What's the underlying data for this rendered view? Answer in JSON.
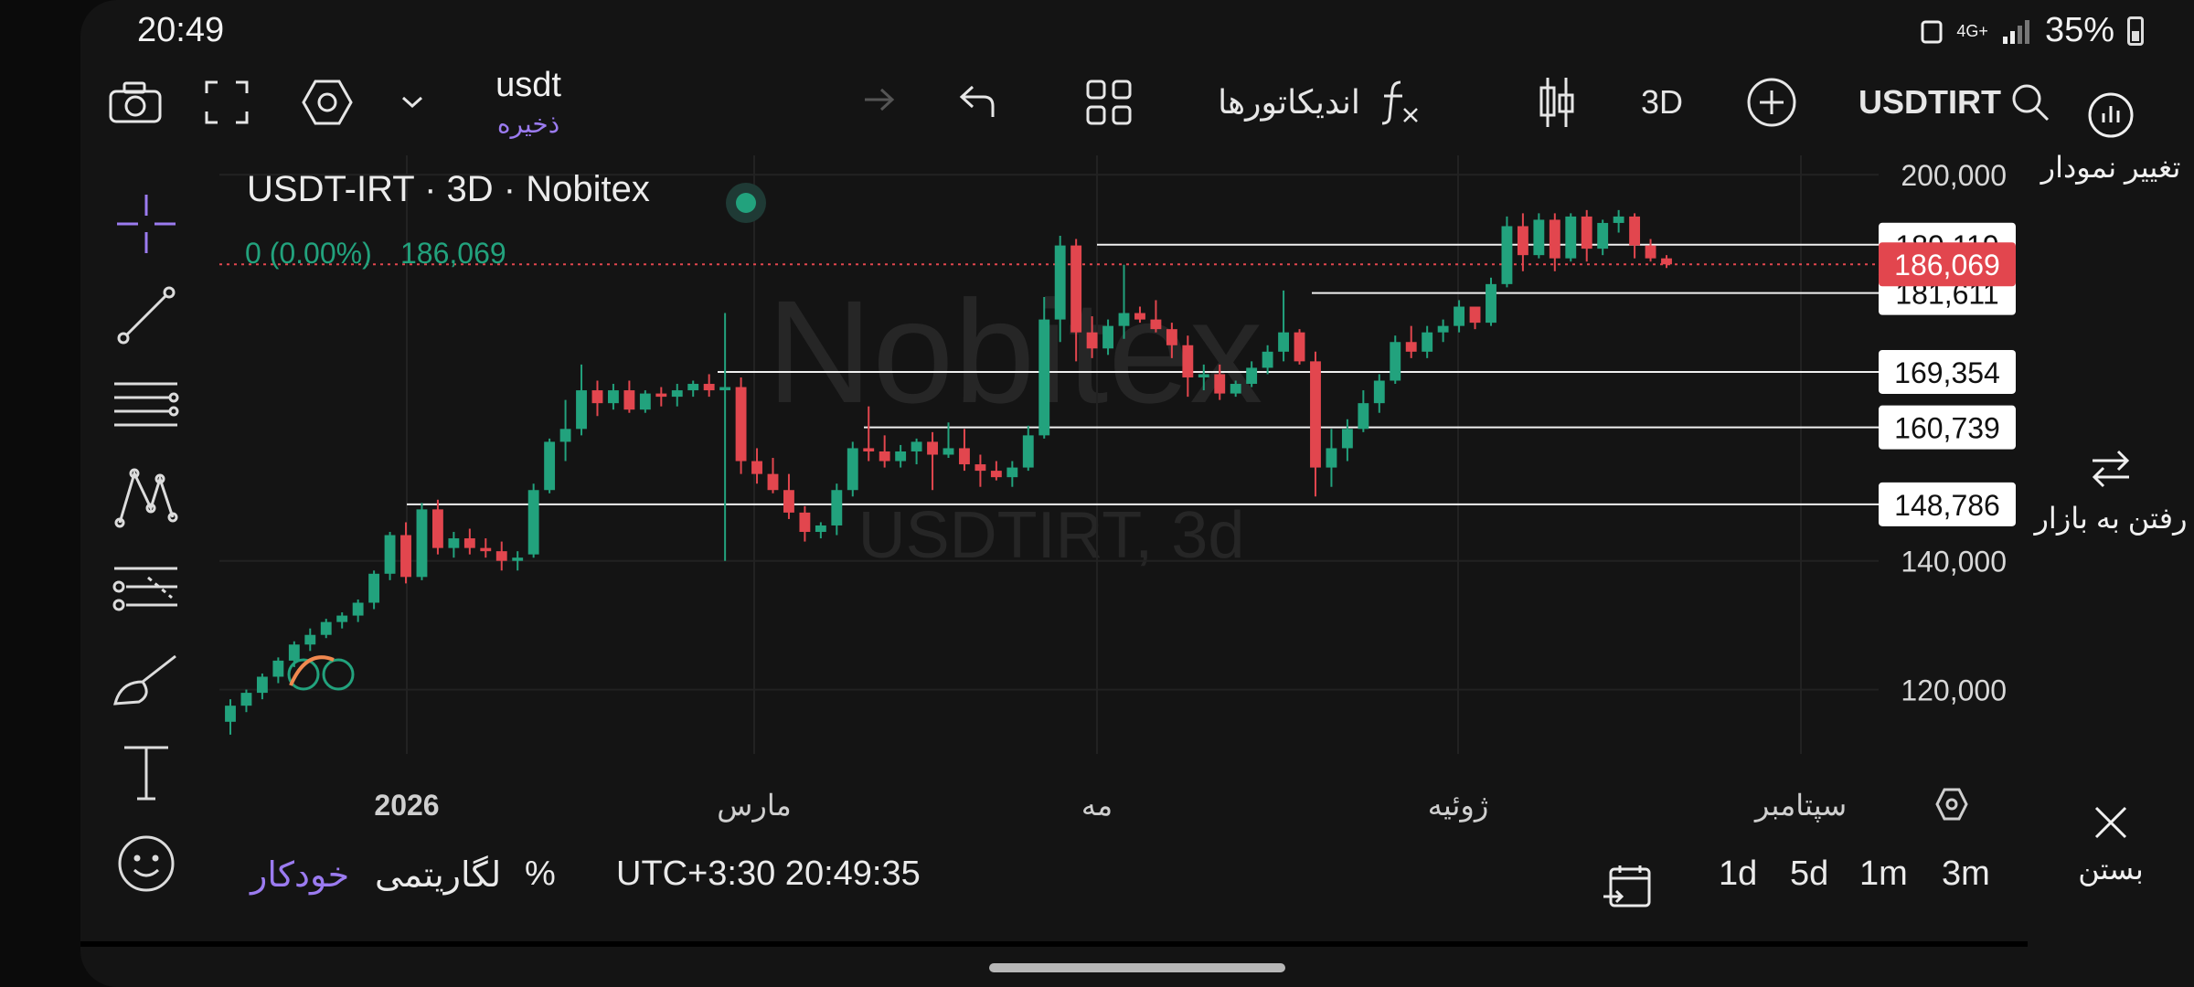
{
  "status_bar": {
    "time": "20:49",
    "network": "4G+",
    "battery": "35%"
  },
  "toolbar": {
    "symbol_name": "usdt",
    "save_label": "ذخیره",
    "indicators_label": "اندیکاتورها",
    "interval_label": "3D",
    "ticker": "USDTIRT"
  },
  "right_sidebar": {
    "change_chart_label": "تغییر نمودار",
    "go_market_label": "رفتن به بازار",
    "close_label": "بستن"
  },
  "chart_header": {
    "title": "USDT-IRT · 3D · Nobitex",
    "change_text": "0 (0.00%)",
    "last_price_text": "186,069"
  },
  "watermark": {
    "line1": "Nobitex",
    "line2": "USDTIRT, 3d"
  },
  "bottom_bar": {
    "auto_label": "خودکار",
    "log_label": "لگاریتمی",
    "percent_label": "%",
    "timezone_clock": "UTC+3:30 20:49:35",
    "ranges": [
      "1d",
      "5d",
      "1m",
      "3m"
    ]
  },
  "colors": {
    "up": "#22a27d",
    "down": "#e2464e",
    "accent": "#9b7bf0",
    "last_price_bg": "#e2464e",
    "background": "#141414"
  },
  "chart_data": {
    "type": "candlestick",
    "title": "USDT-IRT · 3D · Nobitex",
    "x_ticks": [
      "2026",
      "مارس",
      "مه",
      "ژوئیه",
      "سپتامبر"
    ],
    "y_ticks": [
      "200,000",
      "140,000",
      "120,000"
    ],
    "y_tick_values": [
      200000,
      140000,
      120000
    ],
    "ylim": [
      110000,
      203000
    ],
    "last_price": 186069,
    "last_price_label": "186,069",
    "horizontal_levels": [
      {
        "value": 189119,
        "label": "189,119"
      },
      {
        "value": 181611,
        "label": "181,611"
      },
      {
        "value": 169354,
        "label": "169,354"
      },
      {
        "value": 160739,
        "label": "160,739"
      },
      {
        "value": 148786,
        "label": "148,786"
      }
    ],
    "ohlc": [
      [
        115000,
        118500,
        113000,
        117500
      ],
      [
        117500,
        120000,
        116500,
        119500
      ],
      [
        119500,
        122500,
        118500,
        122000
      ],
      [
        122000,
        125000,
        121000,
        124500
      ],
      [
        124500,
        127500,
        123500,
        127000
      ],
      [
        127000,
        129500,
        126000,
        128500
      ],
      [
        128500,
        131000,
        128000,
        130500
      ],
      [
        130500,
        132000,
        129500,
        131500
      ],
      [
        131500,
        134000,
        130500,
        133500
      ],
      [
        133500,
        138500,
        132500,
        138000
      ],
      [
        138000,
        144500,
        137000,
        144000
      ],
      [
        144000,
        146000,
        136500,
        137500
      ],
      [
        137500,
        149000,
        137000,
        148000
      ],
      [
        148000,
        149500,
        141000,
        142000
      ],
      [
        142000,
        144500,
        140500,
        143500
      ],
      [
        143500,
        145000,
        141000,
        142000
      ],
      [
        142000,
        143500,
        140500,
        141500
      ],
      [
        141500,
        143000,
        138500,
        140000
      ],
      [
        140000,
        141500,
        138500,
        140500
      ],
      [
        141000,
        152000,
        140500,
        151000
      ],
      [
        151000,
        159000,
        150500,
        158500
      ],
      [
        158500,
        165000,
        155500,
        160500
      ],
      [
        160500,
        170500,
        159500,
        166500
      ],
      [
        166500,
        168000,
        162500,
        164500
      ],
      [
        164500,
        167500,
        163500,
        166500
      ],
      [
        166500,
        168000,
        163000,
        163500
      ],
      [
        163500,
        166500,
        163000,
        166000
      ],
      [
        166000,
        167000,
        164000,
        165500
      ],
      [
        165500,
        167500,
        164000,
        166500
      ],
      [
        166500,
        168000,
        165500,
        167500
      ],
      [
        167500,
        169000,
        165500,
        166500
      ],
      [
        166500,
        178500,
        140000,
        167000
      ],
      [
        167000,
        168500,
        153500,
        155500
      ],
      [
        155500,
        157500,
        152000,
        153500
      ],
      [
        153500,
        156000,
        150500,
        151000
      ],
      [
        151000,
        153500,
        146500,
        147500
      ],
      [
        147500,
        148500,
        143000,
        144500
      ],
      [
        144500,
        146000,
        143500,
        145500
      ],
      [
        145500,
        152000,
        144000,
        151000
      ],
      [
        151000,
        158500,
        150000,
        157500
      ],
      [
        157500,
        164000,
        155500,
        157000
      ],
      [
        157000,
        159500,
        154500,
        155500
      ],
      [
        155500,
        158000,
        154500,
        157000
      ],
      [
        157000,
        159000,
        155000,
        158500
      ],
      [
        158500,
        160000,
        151000,
        156500
      ],
      [
        156500,
        161500,
        156000,
        157500
      ],
      [
        157500,
        160500,
        154000,
        155000
      ],
      [
        155000,
        156500,
        151500,
        154000
      ],
      [
        154000,
        155500,
        152500,
        153000
      ],
      [
        153000,
        155500,
        151500,
        154500
      ],
      [
        154500,
        161000,
        154000,
        159500
      ],
      [
        159500,
        181000,
        159000,
        177500
      ],
      [
        177500,
        190500,
        174000,
        189000
      ],
      [
        189000,
        190000,
        171000,
        175500
      ],
      [
        175500,
        178000,
        171500,
        173000
      ],
      [
        173000,
        177500,
        172000,
        176500
      ],
      [
        176500,
        186000,
        174500,
        178500
      ],
      [
        178500,
        179500,
        177000,
        177500
      ],
      [
        177500,
        180500,
        175500,
        176000
      ],
      [
        176000,
        177000,
        171500,
        173500
      ],
      [
        173500,
        175000,
        165500,
        168500
      ],
      [
        168500,
        170500,
        166500,
        169000
      ],
      [
        169000,
        170500,
        165000,
        166000
      ],
      [
        166000,
        168000,
        165500,
        167500
      ],
      [
        167500,
        171000,
        167000,
        170000
      ],
      [
        170000,
        173500,
        169000,
        172500
      ],
      [
        172500,
        182000,
        171000,
        175500
      ],
      [
        175500,
        176000,
        170500,
        171000
      ],
      [
        171000,
        172500,
        150000,
        154500
      ],
      [
        154500,
        160500,
        151500,
        157500
      ],
      [
        157500,
        162000,
        155500,
        160500
      ],
      [
        160500,
        166500,
        160000,
        164500
      ],
      [
        164500,
        169000,
        163000,
        168000
      ],
      [
        168000,
        175000,
        167500,
        174000
      ],
      [
        174000,
        176500,
        171500,
        172500
      ],
      [
        172500,
        176500,
        171500,
        175500
      ],
      [
        175500,
        177500,
        174000,
        176500
      ],
      [
        176500,
        180500,
        175500,
        179500
      ],
      [
        179500,
        178500,
        176000,
        177000
      ],
      [
        177000,
        184000,
        176500,
        183000
      ],
      [
        183000,
        193500,
        182500,
        192000
      ],
      [
        192000,
        194000,
        185000,
        187500
      ],
      [
        187500,
        194000,
        187000,
        193000
      ],
      [
        193000,
        194000,
        185000,
        187000
      ],
      [
        187000,
        194000,
        186500,
        193500
      ],
      [
        193500,
        194500,
        186500,
        188500
      ],
      [
        188500,
        193000,
        187500,
        192500
      ],
      [
        192500,
        194500,
        191000,
        193500
      ],
      [
        193500,
        194000,
        187000,
        189000
      ],
      [
        189000,
        190000,
        186500,
        187000
      ],
      [
        187000,
        187500,
        185500,
        186069
      ]
    ]
  }
}
